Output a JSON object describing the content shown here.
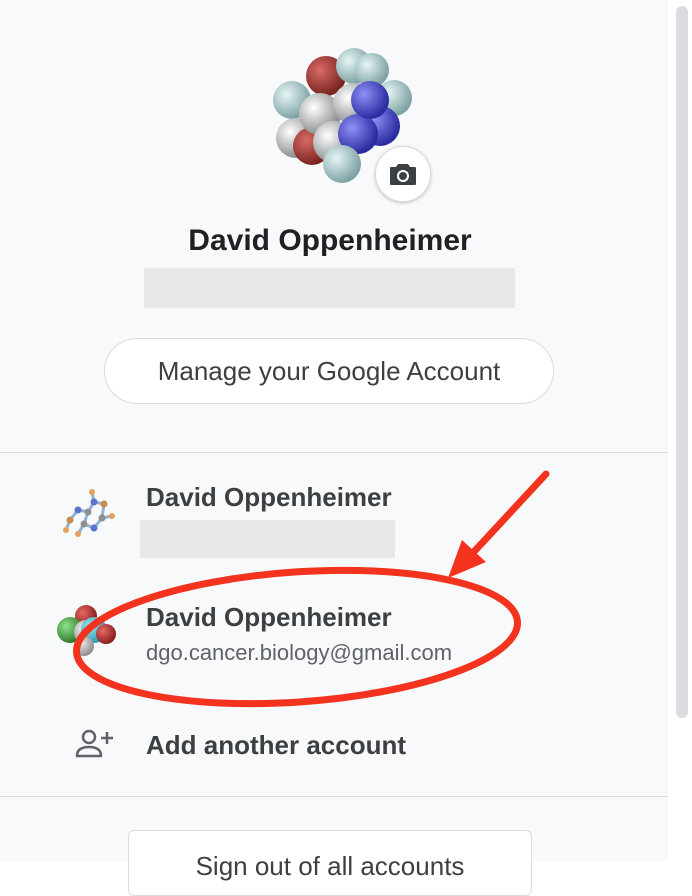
{
  "profile": {
    "name": "David Oppenheimer",
    "manage_button_label": "Manage your Google Account",
    "camera_icon": "camera-icon"
  },
  "accounts": [
    {
      "name": "David Oppenheimer",
      "email": "",
      "avatar_icon": "molecule-ball-stick-avatar"
    },
    {
      "name": "David Oppenheimer",
      "email": "dgo.cancer.biology@gmail.com",
      "avatar_icon": "molecule-space-fill-avatar"
    }
  ],
  "add_account": {
    "label": "Add another account",
    "icon": "person-add-icon"
  },
  "sign_out": {
    "label": "Sign out of all accounts"
  },
  "annotation": {
    "color": "#f4331f",
    "shapes": [
      "arrow",
      "ellipse"
    ]
  }
}
